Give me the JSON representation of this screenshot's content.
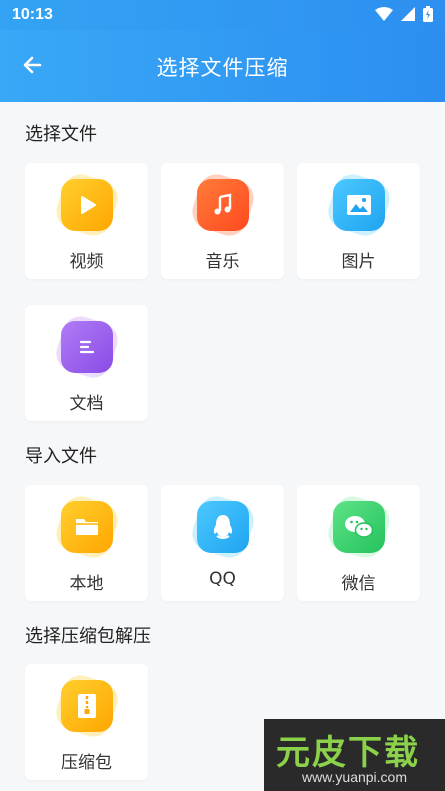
{
  "status_bar": {
    "time": "10:13"
  },
  "app_bar": {
    "title": "选择文件压缩"
  },
  "sections": {
    "select_files": {
      "title": "选择文件",
      "items": [
        "视频",
        "音乐",
        "图片",
        "文档"
      ]
    },
    "import_files": {
      "title": "导入文件",
      "items": [
        "本地",
        "QQ",
        "微信"
      ]
    },
    "extract": {
      "title": "选择压缩包解压",
      "items": [
        "压缩包"
      ]
    }
  },
  "colors": {
    "header_blue": "#2d8ff0",
    "video": "#ffb300",
    "music": "#ff5a2c",
    "image": "#2fb3f5",
    "doc": "#9b59e8",
    "local": "#ffb300",
    "qq": "#2fb3f5",
    "wechat": "#3ed46b",
    "archive": "#ffb300"
  },
  "watermark": {
    "text": "元皮下载",
    "url": "www.yuanpi.com"
  }
}
